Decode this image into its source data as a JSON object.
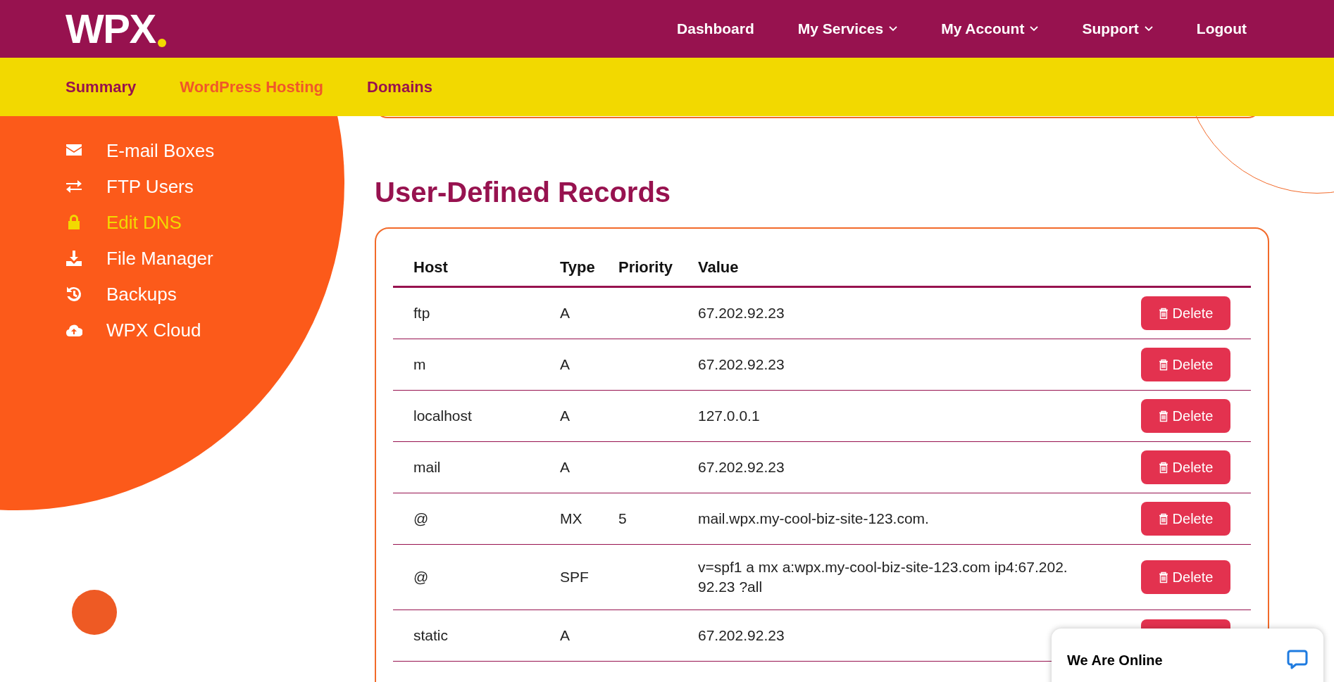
{
  "header": {
    "logo": "WPX",
    "nav": [
      {
        "label": "Dashboard",
        "dropdown": false
      },
      {
        "label": "My Services",
        "dropdown": true
      },
      {
        "label": "My Account",
        "dropdown": true
      },
      {
        "label": "Support",
        "dropdown": true
      },
      {
        "label": "Logout",
        "dropdown": false
      }
    ]
  },
  "subnav": [
    {
      "label": "Summary",
      "selected": false
    },
    {
      "label": "WordPress Hosting",
      "selected": true
    },
    {
      "label": "Domains",
      "selected": false
    }
  ],
  "sidebar": {
    "items": [
      {
        "label": "E-mail Boxes",
        "kind": "mail",
        "selected": false
      },
      {
        "label": "FTP Users",
        "kind": "transfer",
        "selected": false
      },
      {
        "label": "Edit DNS",
        "kind": "lock",
        "selected": true
      },
      {
        "label": "File Manager",
        "kind": "download",
        "selected": false
      },
      {
        "label": "Backups",
        "kind": "history",
        "selected": false
      },
      {
        "label": "WPX Cloud",
        "kind": "cloud",
        "selected": false
      }
    ]
  },
  "records": {
    "title": "User-Defined Records",
    "columns": [
      "Host",
      "Type",
      "Priority",
      "Value"
    ],
    "rows": [
      {
        "host": "ftp",
        "type": "A",
        "value": "67.202.92.23",
        "action": "Delete"
      },
      {
        "host": "m",
        "type": "A",
        "value": "67.202.92.23",
        "action": "Delete"
      },
      {
        "host": "localhost",
        "type": "A",
        "value": "127.0.0.1",
        "action": "Delete"
      },
      {
        "host": "mail",
        "type": "A",
        "value": "67.202.92.23",
        "action": "Delete"
      },
      {
        "host": "@",
        "type": "MX",
        "priority": "5",
        "value": "mail.wpx.my-cool-biz-site-123.com.",
        "action": "Delete"
      },
      {
        "host": "@",
        "type": "SPF",
        "value": "v=spf1 a mx a:wpx.my-cool-biz-site-123.com ip4:67.202.92.23 ?all",
        "action": "Delete"
      },
      {
        "host": "static",
        "type": "A",
        "value": "67.202.92.23"
      }
    ]
  },
  "chat": {
    "title": "We Are Online"
  }
}
